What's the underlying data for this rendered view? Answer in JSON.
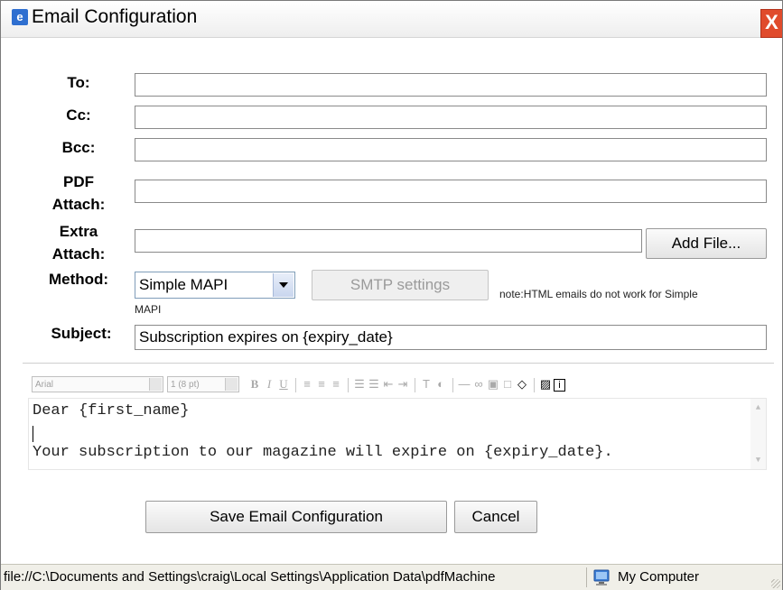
{
  "window": {
    "title": "Email Configuration",
    "close_glyph": "X"
  },
  "form": {
    "to_label": "To:",
    "cc_label": "Cc:",
    "bcc_label": "Bcc:",
    "pdf_attach_label_1": "PDF",
    "pdf_attach_label_2": "Attach:",
    "extra_attach_label_1": "Extra",
    "extra_attach_label_2": "Attach:",
    "method_label": "Method:",
    "subject_label": "Subject:",
    "to_value": "",
    "cc_value": "",
    "bcc_value": "",
    "pdf_attach_value": "",
    "extra_attach_value": "",
    "add_file_label": "Add File...",
    "method_selected": "Simple MAPI",
    "smtp_settings_label": "SMTP settings",
    "method_note_1": "note:HTML emails do not work for Simple",
    "method_note_2": "MAPI",
    "subject_value": "Subscription expires on {expiry_date}"
  },
  "editor_toolbar": {
    "font_name": "Arial",
    "font_size": "1 (8 pt)",
    "bold": "B",
    "italic": "I",
    "underline": "U"
  },
  "editor": {
    "line1": "Dear {first_name}",
    "line3": "Your subscription to our magazine will expire on {expiry_date}."
  },
  "actions": {
    "save_label": "Save Email Configuration",
    "cancel_label": "Cancel"
  },
  "statusbar": {
    "path": "file://C:\\Documents and Settings\\craig\\Local Settings\\Application Data\\pdfMachine",
    "zone": "My Computer"
  },
  "colors": {
    "close_button": "#e04b2c",
    "title_icon": "#2f6fd0"
  }
}
